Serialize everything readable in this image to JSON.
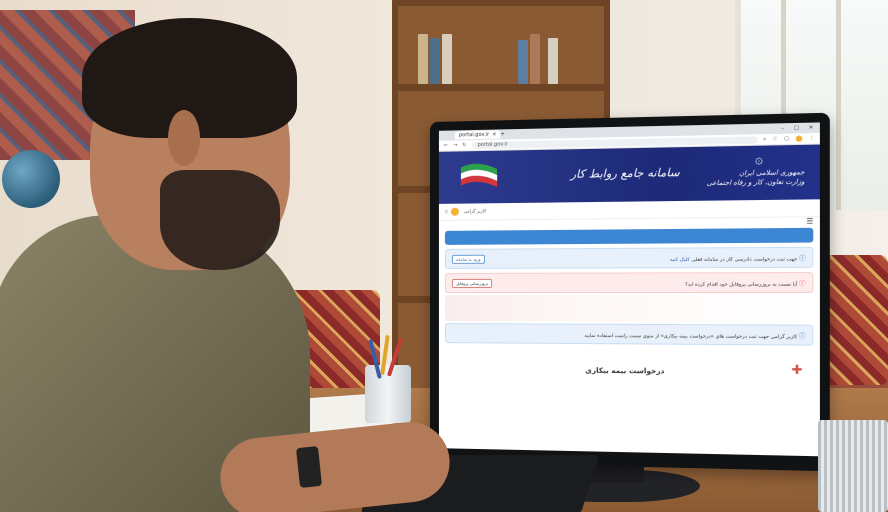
{
  "browser": {
    "tab_title": "portal.gov.ir",
    "url": "portal.gov.ir",
    "window_controls": [
      "–",
      "□",
      "✕"
    ]
  },
  "site": {
    "system_title": "سامانه جامع روابط کار",
    "emblem_icon": "iran-emblem-icon",
    "ministry_line1": "جمهوری اسلامی ایران",
    "ministry_line2": "وزارت تعاون، کار و رفاه اجتماعی",
    "user_label": "کاربر گرامی",
    "menu_icon": "☰"
  },
  "notices": {
    "n1_text": "جهت ثبت درخواست دادرسی کار در سامانه فعلی",
    "n1_link": "کلیک کنید",
    "n1_button": "ورود به سامانه",
    "n2_text": "آیا نسبت به بروزرسانی پروفایل خود اقدام کرده اید؟",
    "n2_button": "بروزرسانی پروفایل",
    "n3_text": "کاربر گرامی جهت ثبت درخواست های «درخواست بیمه بیکاری» از منوی سمت راست استفاده نمایید",
    "request_title": "درخواست بیمه بیکاری"
  },
  "colors": {
    "banner": "#2f3b8f",
    "accent_blue": "#3d86d4",
    "warning": "#d9534f"
  }
}
